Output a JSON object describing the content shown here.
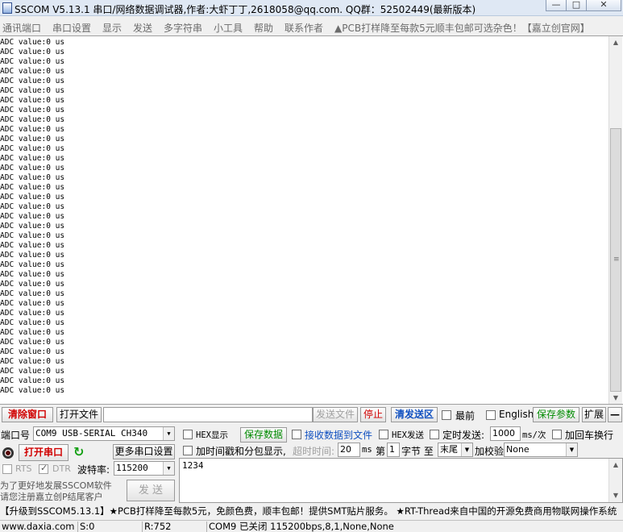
{
  "window": {
    "title": "SSCOM V5.13.1 串口/网络数据调试器,作者:大虾丁丁,2618058@qq.com. QQ群：52502449(最新版本)",
    "min": "—",
    "max": "□",
    "close": "✕"
  },
  "menu": [
    "通讯端口",
    "串口设置",
    "显示",
    "发送",
    "多字符串",
    "小工具",
    "帮助",
    "联系作者",
    "▲PCB打样降至每款5元顺丰包邮可选杂色！【嘉立创官网】"
  ],
  "receive": {
    "line": "ADC value:0 us",
    "line_count": 37
  },
  "toolbar": {
    "clear_window": "清除窗口",
    "open_file": "打开文件",
    "file_path": "",
    "send_file": "发送文件",
    "stop": "停止",
    "clear_send": "清发送区",
    "topmost": "最前",
    "english": "English",
    "save_params": "保存参数",
    "expand": "扩展",
    "collapse": "—"
  },
  "port": {
    "port_label": "端口号",
    "port_value": "COM9 USB-SERIAL CH340",
    "open_port": "打开串口",
    "more_settings": "更多串口设置",
    "rts": "RTS",
    "dtr": "DTR",
    "baud_label": "波特率:",
    "baud_value": "115200",
    "support_msg_1": "为了更好地发展SSCOM软件",
    "support_msg_2": "请您注册嘉立创P结尾客户",
    "send": "发 送"
  },
  "options": {
    "hex_display": "HEX显示",
    "save_data": "保存数据",
    "recv_to_file": "接收数据到文件",
    "hex_send": "HEX发送",
    "timed_send": "定时发送:",
    "interval_value": "1000",
    "interval_unit": "ms/次",
    "add_crlf": "加回车换行",
    "timestamp_split": "加时间戳和分包显示,",
    "timeout_label": "超时时间:",
    "timeout_value": "20",
    "timeout_unit": "ms",
    "byte_label_1": "第",
    "byte_value": "1",
    "byte_label_2": "字节 至",
    "byte_end": "末尾",
    "checksum_label": "加校验",
    "checksum_value": "None"
  },
  "send_text": "1234",
  "promo": "【升级到SSCOM5.13.1】★PCB打样降至每款5元，免颜色费，顺丰包邮！提供SMT贴片服务。 ★RT-Thread来自中国的开源免费商用物联网操作系统",
  "status": {
    "site": "www.daxia.com",
    "sent": "S:0",
    "received": "R:752",
    "port_state": "COM9 已关闭  115200bps,8,1,None,None"
  },
  "colors": {
    "accent_red": "#d00000",
    "accent_green": "#008a00"
  }
}
